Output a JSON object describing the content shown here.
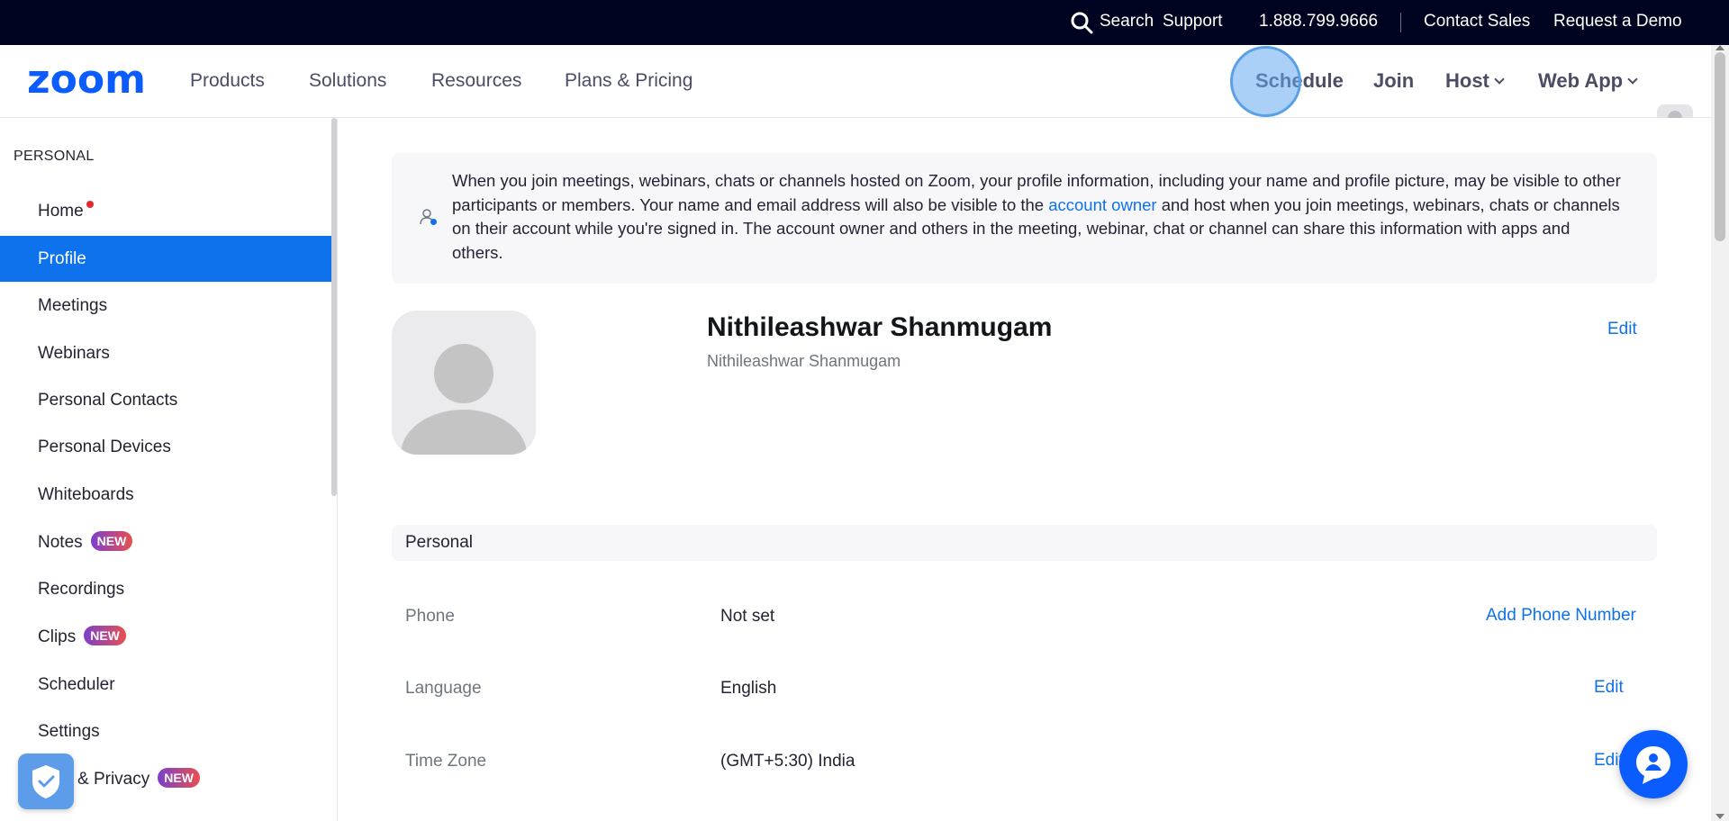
{
  "topbar": {
    "search": "Search",
    "support": "Support",
    "phone": "1.888.799.9666",
    "contact_sales": "Contact Sales",
    "request_demo": "Request a Demo"
  },
  "nav": {
    "logo": "zoom",
    "products": "Products",
    "solutions": "Solutions",
    "resources": "Resources",
    "plans": "Plans & Pricing",
    "schedule": "Schedule",
    "join": "Join",
    "host": "Host",
    "web_app": "Web App"
  },
  "sidebar": {
    "section": "PERSONAL",
    "items": [
      {
        "label": "Home"
      },
      {
        "label": "Profile"
      },
      {
        "label": "Meetings"
      },
      {
        "label": "Webinars"
      },
      {
        "label": "Personal Contacts"
      },
      {
        "label": "Personal Devices"
      },
      {
        "label": "Whiteboards"
      },
      {
        "label": "Notes",
        "badge": "NEW"
      },
      {
        "label": "Recordings"
      },
      {
        "label": "Clips",
        "badge": "NEW"
      },
      {
        "label": "Scheduler"
      },
      {
        "label": "Settings"
      },
      {
        "label": "& Privacy",
        "badge": "NEW"
      }
    ]
  },
  "notice": {
    "text_before": "When you join meetings, webinars, chats or channels hosted on Zoom, your profile information, including your name and profile picture, may be visible to other participants or members. Your name and email address will also be visible to the ",
    "link": "account owner",
    "text_after": " and host when you join meetings, webinars, chats or channels on their account while you're signed in. The account owner and others in the meeting, webinar, chat or channel can share this information with apps and others."
  },
  "profile": {
    "name": "Nithileashwar Shanmugam",
    "display_name": "Nithileashwar Shanmugam",
    "edit": "Edit"
  },
  "personal_section": {
    "title": "Personal",
    "rows": [
      {
        "label": "Phone",
        "value": "Not set",
        "action": "Add Phone Number"
      },
      {
        "label": "Language",
        "value": "English",
        "action": "Edit"
      },
      {
        "label": "Time Zone",
        "value": "(GMT+5:30) India",
        "action": "Edit"
      }
    ]
  },
  "colors": {
    "brand": "#0b5cff",
    "active": "#0e72ed",
    "topbar": "#00031f"
  }
}
